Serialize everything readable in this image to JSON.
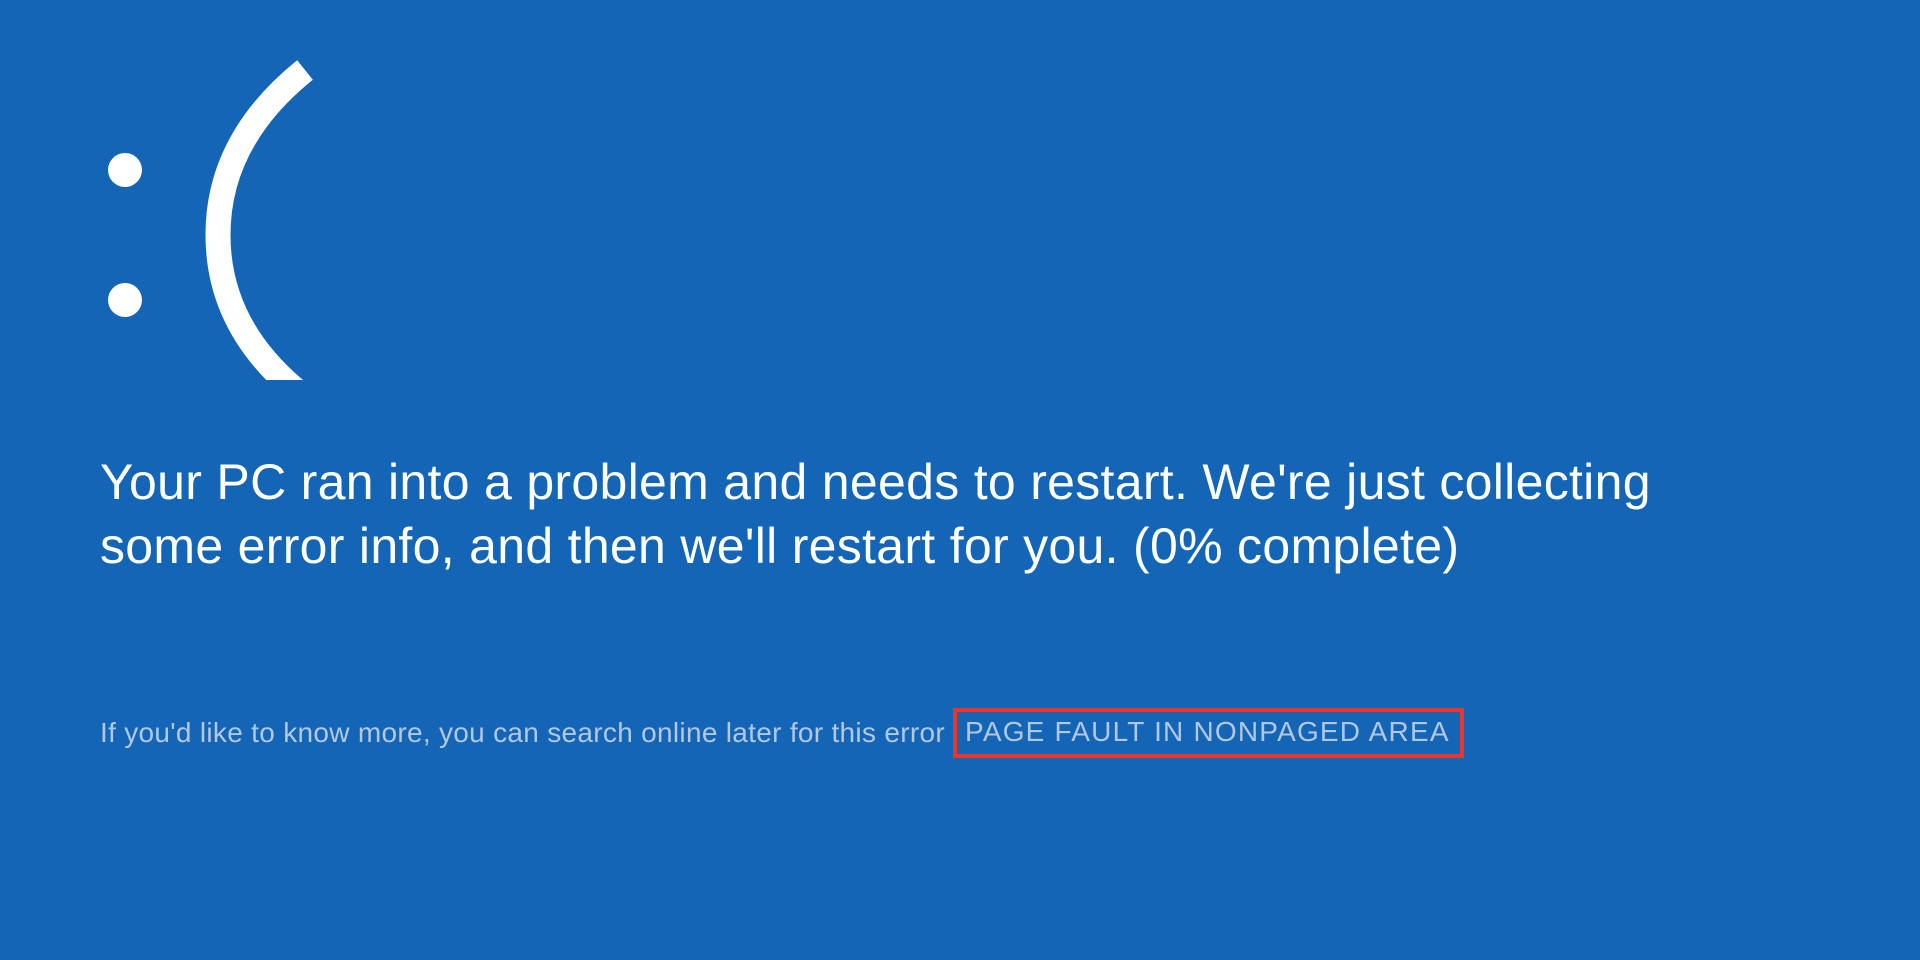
{
  "bsod": {
    "emoticon": ":(",
    "message": "Your PC ran into a problem and needs to restart. We're just collecting some error info, and then we'll restart for you. (0% complete)",
    "footer_prefix": "If you'd like to know more, you can search online later for this error ",
    "error_code": "PAGE FAULT IN NONPAGED AREA",
    "background_color": "#1565b6",
    "highlight_border_color": "#e8362d",
    "progress_percent": 0
  }
}
